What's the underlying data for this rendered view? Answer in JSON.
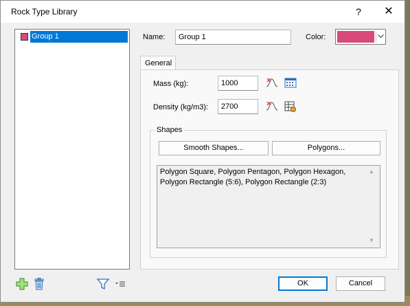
{
  "window": {
    "title": "Rock Type Library",
    "help": "?",
    "close": "✕"
  },
  "tree": {
    "items": [
      {
        "label": "Group 1",
        "color": "#d94a7c"
      }
    ]
  },
  "form": {
    "name_label": "Name:",
    "name_value": "Group 1",
    "color_label": "Color:",
    "color_value": "#d94a7c"
  },
  "tabs": [
    {
      "label": "General"
    }
  ],
  "general": {
    "mass_label": "Mass (kg):",
    "mass_value": "1000",
    "density_label": "Density (kg/m3):",
    "density_value": "2700"
  },
  "shapes": {
    "group_label": "Shapes",
    "smooth_button": "Smooth Shapes...",
    "polygons_button": "Polygons...",
    "list_text": "Polygon Square, Polygon Pentagon, Polygon Hexagon, Polygon Rectangle (5:6), Polygon Rectangle (2:3)"
  },
  "buttons": {
    "ok": "OK",
    "cancel": "Cancel"
  },
  "icons": [
    "add-icon",
    "delete-icon",
    "filter-icon",
    "list-menu-icon",
    "curve-icon",
    "calculator-icon",
    "table-edit-icon"
  ]
}
